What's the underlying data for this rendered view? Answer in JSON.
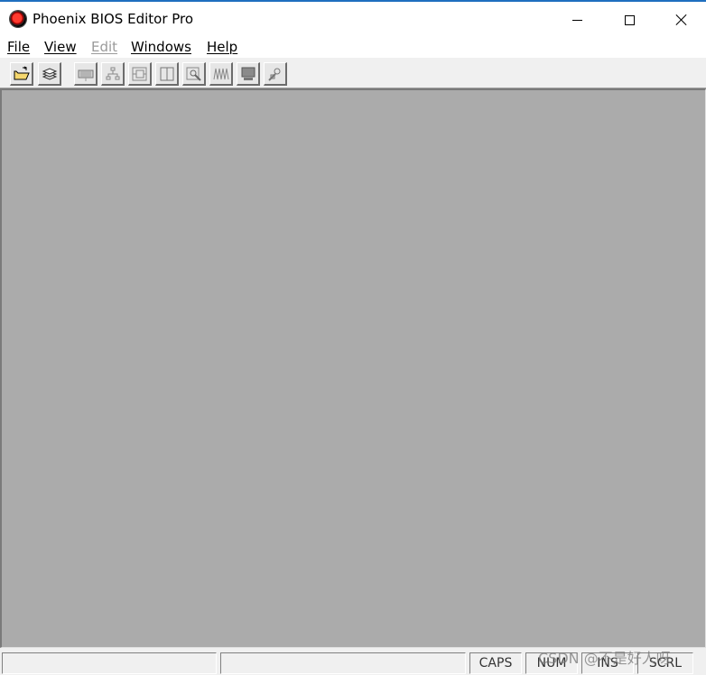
{
  "window": {
    "title": "Phoenix BIOS Editor Pro",
    "title_icon": "phoenix-logo-icon"
  },
  "menu": {
    "items": [
      {
        "label": "File",
        "enabled": true
      },
      {
        "label": "View",
        "enabled": true
      },
      {
        "label": "Edit",
        "enabled": false
      },
      {
        "label": "Windows",
        "enabled": true
      },
      {
        "label": "Help",
        "enabled": true
      }
    ]
  },
  "toolbar": {
    "buttons": [
      {
        "icon": "open-folder-icon"
      },
      {
        "icon": "stack-save-icon"
      },
      {
        "icon": "keyboard-icon"
      },
      {
        "icon": "tree-structure-icon"
      },
      {
        "icon": "component-box-icon"
      },
      {
        "icon": "split-panes-icon"
      },
      {
        "icon": "search-magnifier-icon"
      },
      {
        "icon": "waveform-icon"
      },
      {
        "icon": "monitor-icon"
      },
      {
        "icon": "tools-icon"
      }
    ]
  },
  "statusbar": {
    "caps": "CAPS",
    "num": "NUM",
    "ins": "INS",
    "scrl": "SCRL"
  },
  "watermark": "CSDN @不是好人呀",
  "colors": {
    "workspace": "#ababab",
    "chrome": "#f0f0f0",
    "disabled_text": "#9a9a9a"
  }
}
